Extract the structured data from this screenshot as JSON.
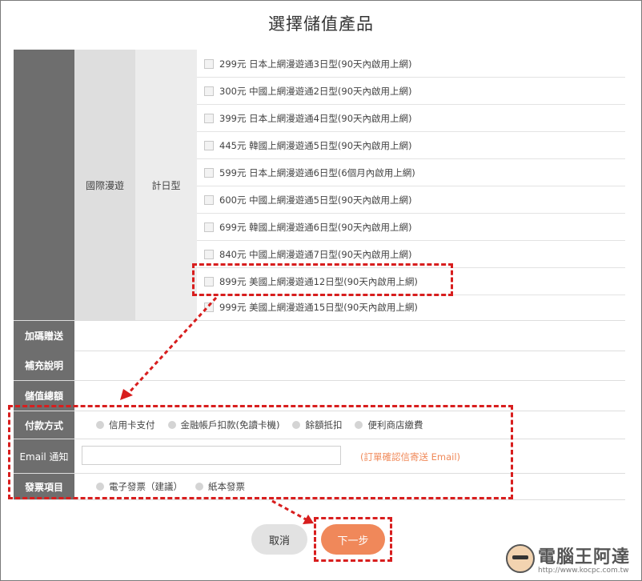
{
  "page_title": "選擇儲值產品",
  "category": "國際漫遊",
  "sub_category": "計日型",
  "products": [
    "299元 日本上網漫遊通3日型(90天內啟用上網)",
    "300元 中國上網漫遊通2日型(90天內啟用上網)",
    "399元 日本上網漫遊通4日型(90天內啟用上網)",
    "445元 韓國上網漫遊通5日型(90天內啟用上網)",
    "599元 日本上網漫遊通6日型(6個月內啟用上網)",
    "600元 中國上網漫遊通5日型(90天內啟用上網)",
    "699元 韓國上網漫遊通6日型(90天內啟用上網)",
    "840元 中國上網漫遊通7日型(90天內啟用上網)",
    "899元 美國上網漫遊通12日型(90天內啟用上網)",
    "999元 美國上網漫遊通15日型(90天內啟用上網)"
  ],
  "rows": {
    "promo_label": "加碼贈送",
    "note_label": "補充說明",
    "total_label": "儲值總額",
    "payment_label": "付款方式",
    "email_label": "Email 通知",
    "invoice_label": "發票項目"
  },
  "payment_options": [
    "信用卡支付",
    "金融帳戶扣款(免讀卡機)",
    "餘額抵扣",
    "便利商店繳費"
  ],
  "email": {
    "value": "",
    "note": "(訂單確認信寄送 Email)"
  },
  "invoice_options": [
    "電子發票（建議）",
    "紙本發票"
  ],
  "buttons": {
    "cancel": "取消",
    "next": "下一步"
  },
  "watermark": {
    "text": "電腦王阿達",
    "url": "http://www.kocpc.com.tw"
  },
  "colors": {
    "accent": "#f0885a",
    "header_dark": "#6e6e6e",
    "highlight": "#d81e1e"
  }
}
